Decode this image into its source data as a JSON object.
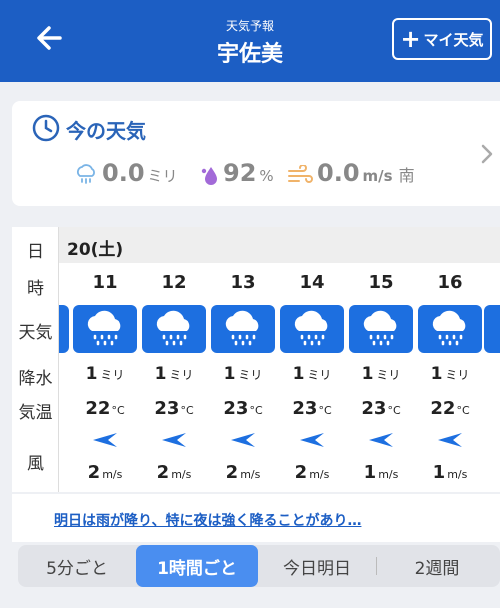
{
  "header": {
    "subtitle": "天気予報",
    "title": "宇佐美",
    "my_weather_label": "マイ天気",
    "plus_glyph": "+"
  },
  "current": {
    "title": "今の天気",
    "precip_value": "0.0",
    "precip_unit": "ミリ",
    "humidity_value": "92",
    "humidity_unit": "%",
    "wind_value": "0.0",
    "wind_unit": "m/s",
    "wind_dir": "南"
  },
  "forecast": {
    "labels": {
      "day": "日",
      "hour": "時",
      "weather": "天気",
      "precip": "降水",
      "temp": "気温",
      "wind": "風"
    },
    "day": "20(土)",
    "precip_unit": "ミリ",
    "temp_unit": "°C",
    "wind_unit": "m/s",
    "hours": [
      {
        "hour": "11",
        "weather_icon": "rain-cloud-icon",
        "precip": "1",
        "temp": "22",
        "wind_speed": "2",
        "wind_dir": "east"
      },
      {
        "hour": "12",
        "weather_icon": "rain-cloud-icon",
        "precip": "1",
        "temp": "23",
        "wind_speed": "2",
        "wind_dir": "east"
      },
      {
        "hour": "13",
        "weather_icon": "rain-cloud-icon",
        "precip": "1",
        "temp": "23",
        "wind_speed": "2",
        "wind_dir": "east"
      },
      {
        "hour": "14",
        "weather_icon": "rain-cloud-icon",
        "precip": "1",
        "temp": "23",
        "wind_speed": "2",
        "wind_dir": "east"
      },
      {
        "hour": "15",
        "weather_icon": "rain-cloud-icon",
        "precip": "1",
        "temp": "23",
        "wind_speed": "1",
        "wind_dir": "east"
      },
      {
        "hour": "16",
        "weather_icon": "rain-cloud-icon",
        "precip": "1",
        "temp": "22",
        "wind_speed": "1",
        "wind_dir": "east"
      }
    ]
  },
  "banner": {
    "text": "明日は雨が降り、特に夜は強く降ることがあり…"
  },
  "segments": {
    "five_min": "5分ごと",
    "hourly": "1時間ごと",
    "today_tomorrow": "今日明日",
    "two_weeks": "2週間",
    "active": "hourly"
  },
  "colors": {
    "header_bg": "#1c5ec4",
    "tile_bg": "#1d6fe0",
    "active_seg": "#4a8ef0",
    "link": "#1c5ec4",
    "humidity_drop": "#a26ad8",
    "wind_icon": "#f0b36a",
    "rain_icon": "#7ab4e6"
  }
}
